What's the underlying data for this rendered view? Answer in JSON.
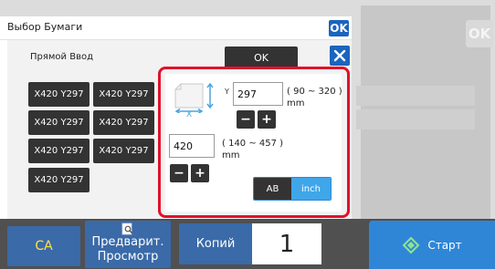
{
  "dialog": {
    "title": "Выбор Бумаги",
    "ok_badge": "OK",
    "mode_label": "Прямой Ввод",
    "ok_button": "OK"
  },
  "presets": [
    "X420 Y297",
    "X420 Y297",
    "X420 Y297",
    "X420 Y297",
    "X420 Y297",
    "X420 Y297",
    "X420 Y297"
  ],
  "custom_size": {
    "y_axis_label": "Y",
    "x_axis_label": "X",
    "y_value": "297",
    "y_range": "( 90 ~ 320 )",
    "y_unit": "mm",
    "x_value": "420",
    "x_range": "( 140 ~ 457 )",
    "x_unit": "mm",
    "minus": "−",
    "plus": "+",
    "unit_ab": "AB",
    "unit_inch": "inch"
  },
  "background": {
    "ok_badge": "OK"
  },
  "bottom_bar": {
    "ca_label": "CA",
    "preview_line1": "Предварит.",
    "preview_line2": "Просмотр",
    "copies_label": "Копий",
    "copies_count": "1",
    "start_label": "Старт"
  },
  "colors": {
    "accent_blue": "#1a64c0",
    "highlight_red": "#e0112b",
    "start_blue": "#2f86d6",
    "ca_yellow": "#ffe14b"
  },
  "icons": [
    "close-icon",
    "preview-icon",
    "start-icon",
    "paper-size-icon"
  ]
}
